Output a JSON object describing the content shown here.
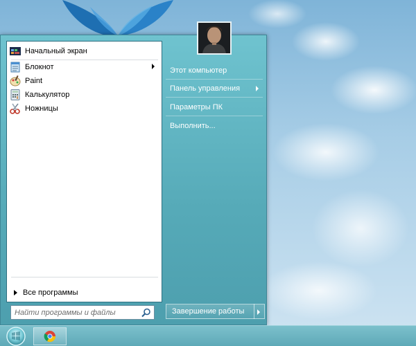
{
  "start_menu": {
    "pinned": [
      {
        "label": "Начальный экран",
        "icon": "start-screen-icon"
      },
      {
        "label": "Блокнот",
        "icon": "notepad-icon",
        "has_submenu": true
      },
      {
        "label": "Paint",
        "icon": "paint-icon"
      },
      {
        "label": "Калькулятор",
        "icon": "calculator-icon"
      },
      {
        "label": "Ножницы",
        "icon": "scissors-icon"
      }
    ],
    "all_programs": "Все программы",
    "search_placeholder": "Найти программы и файлы",
    "right": [
      {
        "label": "Этот компьютер"
      },
      {
        "label": "Панель управления",
        "has_submenu": true
      },
      {
        "label": "Параметры ПК"
      },
      {
        "label": "Выполнить..."
      }
    ],
    "shutdown": "Завершение работы"
  },
  "taskbar": {
    "items": [
      {
        "name": "start-button",
        "icon": "start-orb-icon"
      },
      {
        "name": "chrome",
        "icon": "chrome-icon"
      }
    ]
  }
}
